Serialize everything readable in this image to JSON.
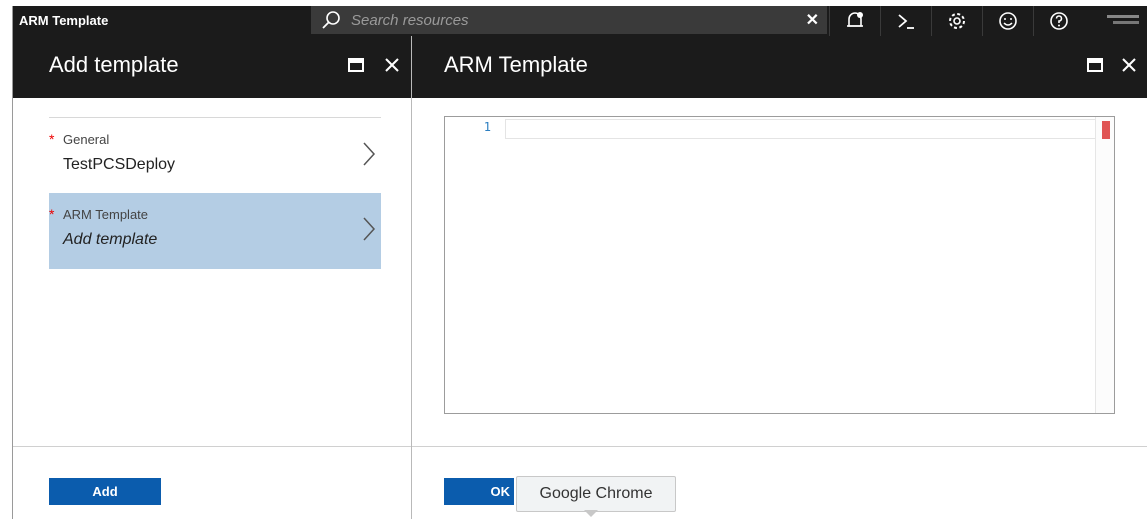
{
  "app": {
    "title": "ARM Template"
  },
  "search": {
    "placeholder": "Search resources",
    "clear_icon": "close-icon"
  },
  "top_icons": [
    "notifications-icon",
    "cloud-shell-icon",
    "settings-icon",
    "feedback-icon",
    "help-icon"
  ],
  "left_blade": {
    "title": "Add template",
    "items": [
      {
        "label": "General",
        "value": "TestPCSDeploy",
        "required": true,
        "selected": false
      },
      {
        "label": "ARM Template",
        "value": "Add template",
        "required": true,
        "selected": true
      }
    ],
    "add_label": "Add"
  },
  "right_blade": {
    "title": "ARM Template",
    "editor": {
      "line_numbers": [
        "1"
      ]
    },
    "ok_label": "OK"
  },
  "tooltip": {
    "text": "Google Chrome"
  },
  "colors": {
    "accent": "#0b5cad",
    "header": "#1b1b1b",
    "selected": "#b4cde4",
    "required": "#e00000"
  }
}
